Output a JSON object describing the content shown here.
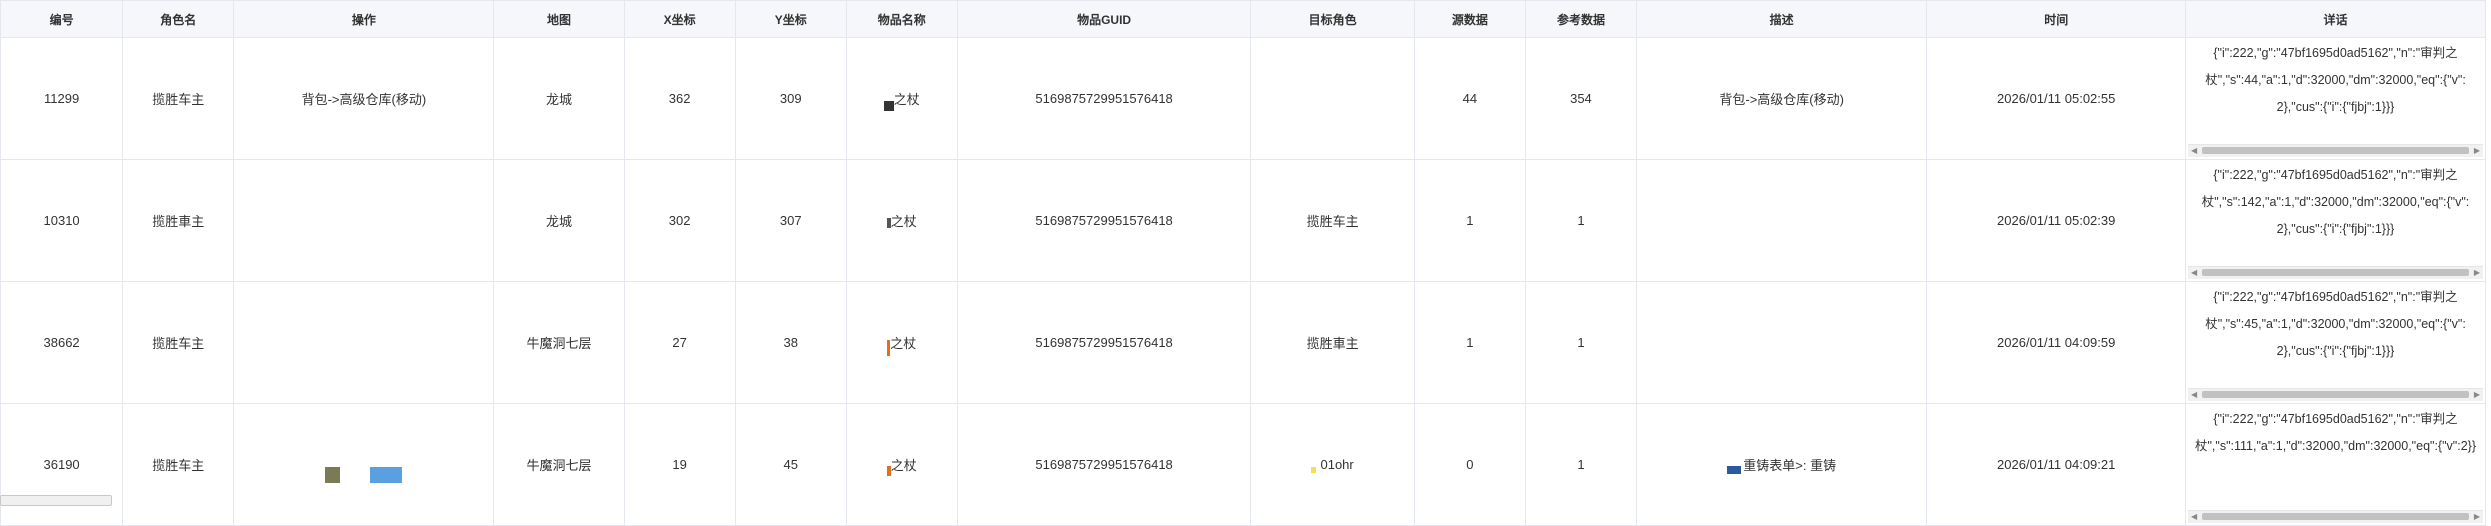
{
  "columns": [
    "编号",
    "角色名",
    "操作",
    "地图",
    "X坐标",
    "Y坐标",
    "物品名称",
    "物品GUID",
    "目标角色",
    "源数据",
    "参考数据",
    "描述",
    "时间",
    "详话"
  ],
  "rows": [
    {
      "id": "11299",
      "role": "揽胜车主",
      "operation": "背包->高级仓库(移动)",
      "map": "龙城",
      "x": "362",
      "y": "309",
      "item_name": "之杖",
      "guid": "5169875729951576418",
      "target": "",
      "source": "44",
      "reference": "354",
      "description": "背包->高级仓库(移动)",
      "time": "2026/01/11 05:02:55",
      "detail": "{\"i\":222,\"g\":\"47bf1695d0ad5162\",\"n\":\"审判之杖\",\"s\":44,\"a\":1,\"d\":32000,\"dm\":32000,\"eq\":{\"v\":2},\"cus\":{\"i\":{\"fjbj\":1}}}"
    },
    {
      "id": "10310",
      "role": "揽胜車主",
      "operation": "",
      "map": "龙城",
      "x": "302",
      "y": "307",
      "item_name": "之杖",
      "guid": "5169875729951576418",
      "target": "揽胜车主",
      "source": "1",
      "reference": "1",
      "description": "",
      "time": "2026/01/11 05:02:39",
      "detail": "{\"i\":222,\"g\":\"47bf1695d0ad5162\",\"n\":\"审判之杖\",\"s\":142,\"a\":1,\"d\":32000,\"dm\":32000,\"eq\":{\"v\":2},\"cus\":{\"i\":{\"fjbj\":1}}}"
    },
    {
      "id": "38662",
      "role": "揽胜车主",
      "operation": "",
      "map": "牛魔洞七层",
      "x": "27",
      "y": "38",
      "item_name": "之杖",
      "guid": "5169875729951576418",
      "target": "揽胜車主",
      "source": "1",
      "reference": "1",
      "description": "",
      "time": "2026/01/11 04:09:59",
      "detail": "{\"i\":222,\"g\":\"47bf1695d0ad5162\",\"n\":\"审判之杖\",\"s\":45,\"a\":1,\"d\":32000,\"dm\":32000,\"eq\":{\"v\":2},\"cus\":{\"i\":{\"fjbj\":1}}}"
    },
    {
      "id": "36190",
      "role": "揽胜车主",
      "operation": "",
      "map": "牛魔洞七层",
      "x": "19",
      "y": "45",
      "item_name": "之杖",
      "guid": "5169875729951576418",
      "target": "01ohr",
      "source": "0",
      "reference": "1",
      "description": "重铸表单>: 重铸",
      "time": "2026/01/11 04:09:21",
      "detail": "{\"i\":222,\"g\":\"47bf1695d0ad5162\",\"n\":\"审判之杖\",\"s\":111,\"a\":1,\"d\":32000,\"dm\":32000,\"eq\":{\"v\":2}}"
    }
  ],
  "icons": {
    "scroll_left": "triangle-left-icon",
    "scroll_right": "triangle-right-icon"
  },
  "colors": {
    "header_bg": "#f5f7fa",
    "border": "#e4e7ed",
    "blot_dark": "#333333",
    "blot_olive": "#7a7a55",
    "blot_blue": "#5aa0e0",
    "blot_orange": "#e07020",
    "blot_navy": "#2a5aa0",
    "blot_yellow": "#f5e050"
  }
}
